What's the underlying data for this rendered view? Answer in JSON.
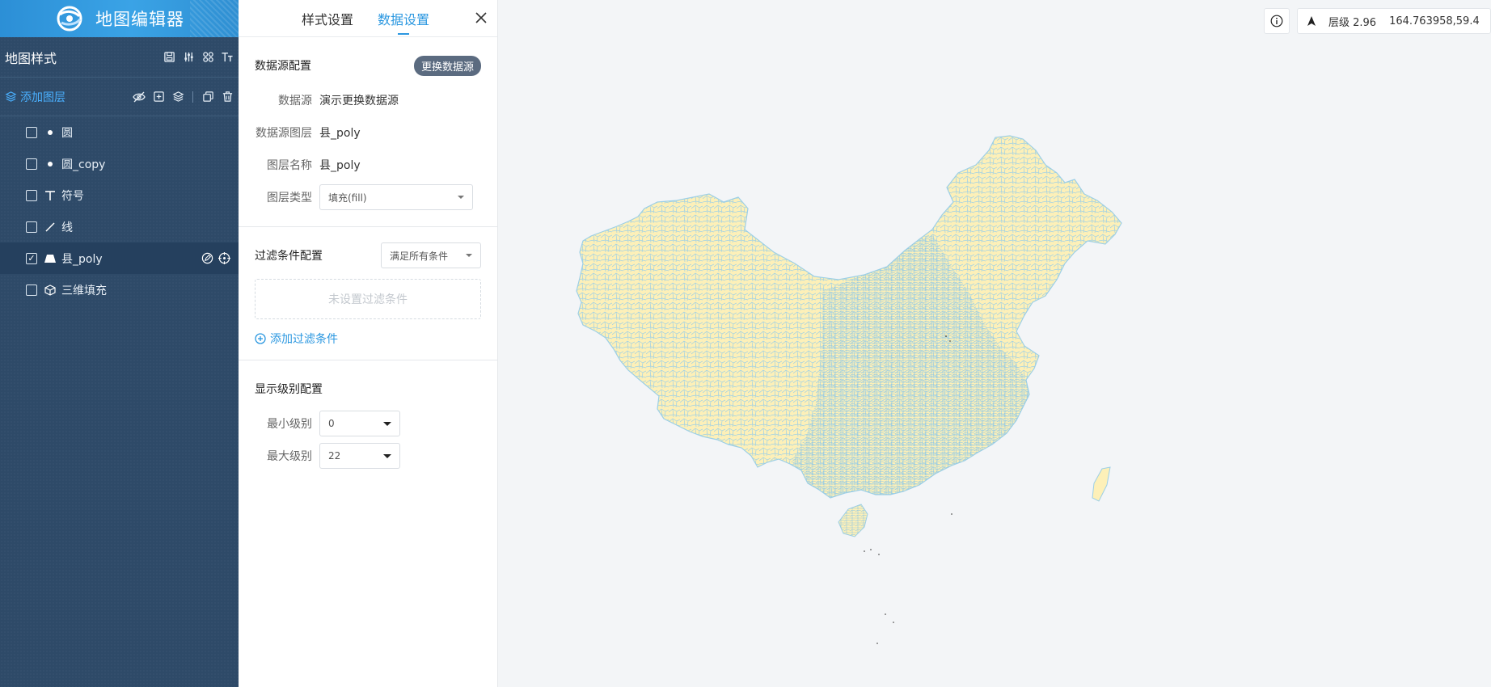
{
  "app": {
    "title": "地图编辑器"
  },
  "sidebar": {
    "style_title": "地图样式",
    "add_layer_label": "添加图层",
    "layers": [
      {
        "name": "圆",
        "icon": "dot-icon",
        "checked": false,
        "selected": false
      },
      {
        "name": "圆_copy",
        "icon": "dot-icon",
        "checked": false,
        "selected": false
      },
      {
        "name": "符号",
        "icon": "text-t-icon",
        "checked": false,
        "selected": false
      },
      {
        "name": "线",
        "icon": "line-icon",
        "checked": false,
        "selected": false
      },
      {
        "name": "县_poly",
        "icon": "fill-polygon-icon",
        "checked": true,
        "selected": true
      },
      {
        "name": "三维填充",
        "icon": "cube-icon",
        "checked": false,
        "selected": false
      }
    ]
  },
  "panel": {
    "tabs": [
      "样式设置",
      "数据设置"
    ],
    "active_tab": "数据设置",
    "datasource": {
      "title": "数据源配置",
      "change_button": "更换数据源",
      "rows": [
        {
          "label": "数据源",
          "value": "演示更换数据源"
        },
        {
          "label": "数据源图层",
          "value": "县_poly"
        },
        {
          "label": "图层名称",
          "value": "县_poly"
        }
      ],
      "layer_type_label": "图层类型",
      "layer_type_value": "填充(fill)"
    },
    "filter": {
      "title": "过滤条件配置",
      "mode_value": "满足所有条件",
      "empty_text": "未设置过滤条件",
      "add_label": "添加过滤条件"
    },
    "zoom": {
      "title": "显示级别配置",
      "min_label": "最小级别",
      "min_value": "0",
      "max_label": "最大级别",
      "max_value": "22"
    }
  },
  "map": {
    "zoom_label": "层级 2.96",
    "coords": "164.763958,59.4",
    "fill_color": "#fdf0b8",
    "stroke_color": "#9ccfe6"
  }
}
